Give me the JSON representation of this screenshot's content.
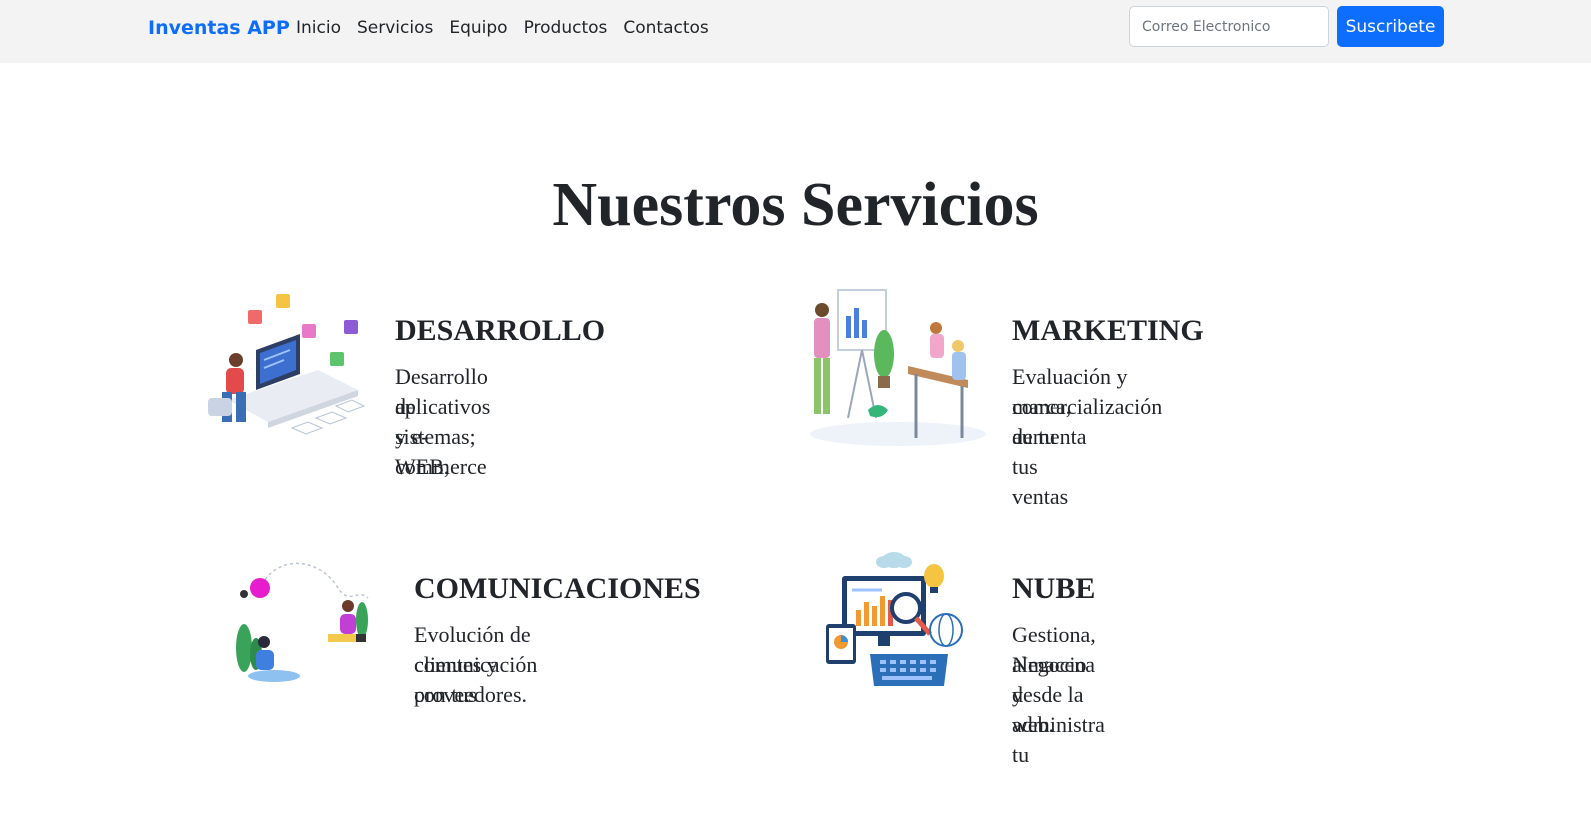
{
  "navbar": {
    "brand": "Inventas APP",
    "links": [
      "Inicio",
      "Servicios",
      "Equipo",
      "Productos",
      "Contactos"
    ],
    "email_placeholder": "Correo Electronico",
    "subscribe_label": "Suscribete"
  },
  "section": {
    "title": "Nuestros Servicios"
  },
  "services": [
    {
      "title": "DESARROLLO",
      "description_line1": "Desarrollo de sistemas; WEB,",
      "description_line2": "aplicativos y e-commerce"
    },
    {
      "title": "MARKETING",
      "description_line1": "Evaluación y comercialización de tu",
      "description_line2": "marca, aumenta tus ventas"
    },
    {
      "title": "COMUNICACIONES",
      "description_line1": "Evolución de comunicación con tus",
      "description_line2": "clientes y proveedores."
    },
    {
      "title": "NUBE",
      "description_line1": "Gestiona, almacena y administra tu",
      "description_line2": "Negocio desde la web."
    }
  ],
  "colors": {
    "brand": "#0d6efd",
    "navbar_bg": "#f3f3f3",
    "text": "#212529"
  },
  "icons": [
    "developer-illustration-icon",
    "marketing-illustration-icon",
    "communications-illustration-icon",
    "cloud-illustration-icon"
  ]
}
